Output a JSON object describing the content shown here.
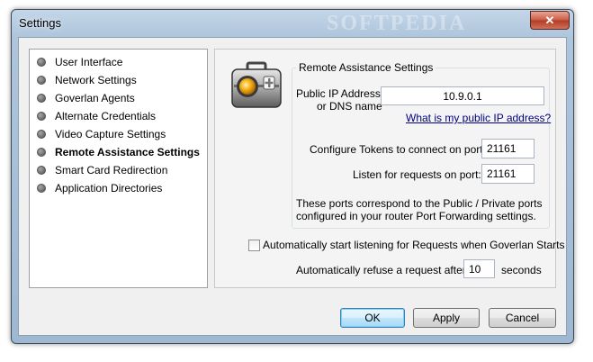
{
  "window": {
    "title": "Settings",
    "watermark": "SOFTPEDIA",
    "close_glyph": "✕"
  },
  "nav": {
    "items": [
      {
        "label": "User Interface",
        "active": false
      },
      {
        "label": "Network Settings",
        "active": false
      },
      {
        "label": "Goverlan Agents",
        "active": false
      },
      {
        "label": "Alternate Credentials",
        "active": false
      },
      {
        "label": "Video Capture Settings",
        "active": false
      },
      {
        "label": "Remote Assistance Settings",
        "active": true
      },
      {
        "label": "Smart Card Redirection",
        "active": false
      },
      {
        "label": "Application Directories",
        "active": false
      }
    ]
  },
  "panel": {
    "icon": "toolbox-icon",
    "group_title": "Remote Assistance Settings",
    "public_ip_label_line1": "Public IP Address:",
    "public_ip_label_line2": "or DNS name",
    "public_ip_value": "10.9.0.1",
    "public_ip_link": "What is my public IP address?",
    "tokens_label": "Configure Tokens to connect on port:",
    "tokens_port": "21161",
    "listen_label": "Listen for requests on port:",
    "listen_port": "21161",
    "info_line1": "These ports correspond to the Public / Private ports",
    "info_line2": "configured in your router Port Forwarding settings.",
    "autostart_label": "Automatically start listening for Requests when Goverlan Starts",
    "autostart_checked": false,
    "refuse_label": "Automatically refuse a request after :",
    "refuse_value": "10",
    "refuse_unit": "seconds"
  },
  "buttons": {
    "ok": "OK",
    "apply": "Apply",
    "cancel": "Cancel"
  }
}
